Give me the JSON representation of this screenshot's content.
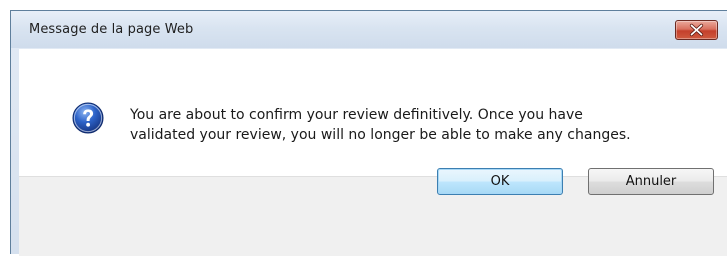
{
  "window": {
    "title": "Message de la page Web"
  },
  "dialog": {
    "message_line1": "You are about to confirm your review definitively. Once you have",
    "message_line2": "validated your review, you will no longer be able to make any changes.",
    "icon": "question-icon"
  },
  "buttons": {
    "ok_label": "OK",
    "cancel_label": "Annuler"
  },
  "colors": {
    "close_button": "#c4402c",
    "question_icon": "#1f4fae",
    "default_button_border": "#3c7fb1"
  }
}
